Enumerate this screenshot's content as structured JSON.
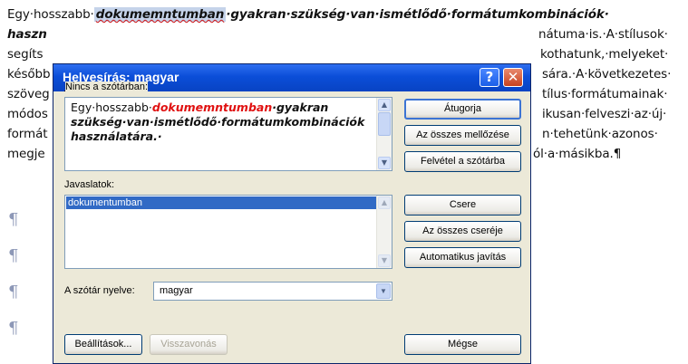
{
  "document": {
    "line1_pre": "Egy·hosszabb·",
    "line1_highlight": "dokumemntumban",
    "line1_post": "·gyakran·szükség·van·ismétlődő·formátumkombinációk·",
    "line2_left": "haszn",
    "line2_right": "nátuma·is.·A·stílusok·",
    "line3_left": "segíts",
    "line3_right": "kothatunk,·melyeket·",
    "line4_left": "később",
    "line4_right": "sára.·A·következetes·",
    "line5_left": "szöveg",
    "line5_right": "tílus·formátumainak·",
    "line6_left": "módos",
    "line6_right": "ikusan·felveszi·az·új·",
    "line7_left": "formát",
    "line7_right": "n·tehetünk·azonos·",
    "line8_left": "megje",
    "line8_right": "ól·a·másikba.¶",
    "pilcrow": "¶"
  },
  "dialog": {
    "title": "Helyesírás: magyar",
    "help_icon": "?",
    "close_icon": "✕",
    "not_in_dictionary_label": "Nincs a szótárban:",
    "not_in_text_pre": "Egy·hosszabb·",
    "not_in_text_error": "dokumemntumban",
    "not_in_text_post": "·gyakran szükség·van·ismétlődő·formátumkombinációk használatára.·",
    "suggestions_label": "Javaslatok:",
    "suggestions": [
      "dokumentumban"
    ],
    "language_label": "A szótár nyelve:",
    "language_value": "magyar",
    "buttons": {
      "ignore_once": "Átugorja",
      "ignore_all": "Az összes mellőzése",
      "add_to_dictionary": "Felvétel a szótárba",
      "change": "Csere",
      "change_all": "Az összes cseréje",
      "autocorrect": "Automatikus javítás",
      "options": "Beállítások...",
      "undo": "Visszavonás",
      "cancel": "Mégse"
    }
  },
  "colors": {
    "titlebar": "#0b4ed8",
    "dialog_bg": "#ece9d8",
    "error_text": "#e01010",
    "selection": "#316ac5"
  }
}
